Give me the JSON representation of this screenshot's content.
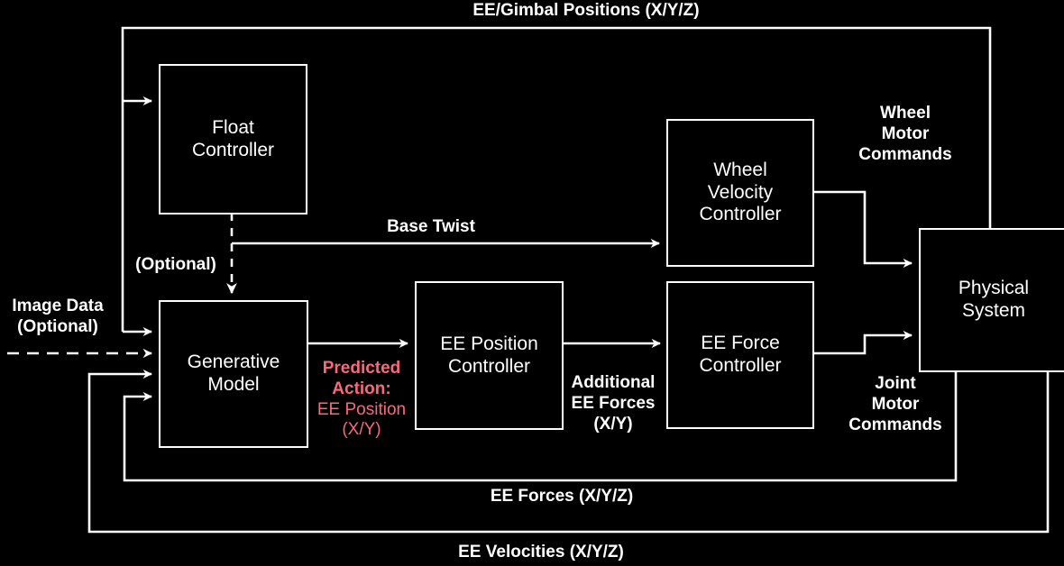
{
  "diagram": {
    "title": "Robot control architecture block diagram",
    "background_color": "#000000",
    "line_color": "#ffffff",
    "accent_color": "#f9697a",
    "blocks": [
      {
        "id": "float_controller",
        "label": "Float\nController"
      },
      {
        "id": "generative_model",
        "label": "Generative\nModel"
      },
      {
        "id": "ee_position_controller",
        "label": "EE Position\nController"
      },
      {
        "id": "wheel_velocity_controller",
        "label": "Wheel\nVelocity\nController"
      },
      {
        "id": "ee_force_controller",
        "label": "EE Force\nController"
      },
      {
        "id": "physical_system",
        "label": "Physical\nSystem"
      }
    ],
    "edge_labels": [
      {
        "id": "ee_gimbal_positions",
        "text": "EE/Gimbal Positions (X/Y/Z)"
      },
      {
        "id": "base_twist",
        "text": "Base Twist"
      },
      {
        "id": "optional_float",
        "text": "(Optional)"
      },
      {
        "id": "image_data",
        "text": "Image Data\n(Optional)"
      },
      {
        "id": "wheel_motor_commands",
        "text": "Wheel\nMotor\nCommands"
      },
      {
        "id": "joint_motor_commands",
        "text": "Joint\nMotor\nCommands"
      },
      {
        "id": "additional_ee_forces",
        "text": "Additional\nEE Forces\n(X/Y)"
      },
      {
        "id": "ee_forces_feedback",
        "text": "EE Forces (X/Y/Z)"
      },
      {
        "id": "ee_velocities_feedback",
        "text": "EE Velocities (X/Y/Z)"
      }
    ],
    "predicted_action": {
      "bold_line_1": "Predicted",
      "bold_line_2": "Action:",
      "plain_line_1": "EE Position",
      "plain_line_2": "(X/Y)"
    }
  }
}
